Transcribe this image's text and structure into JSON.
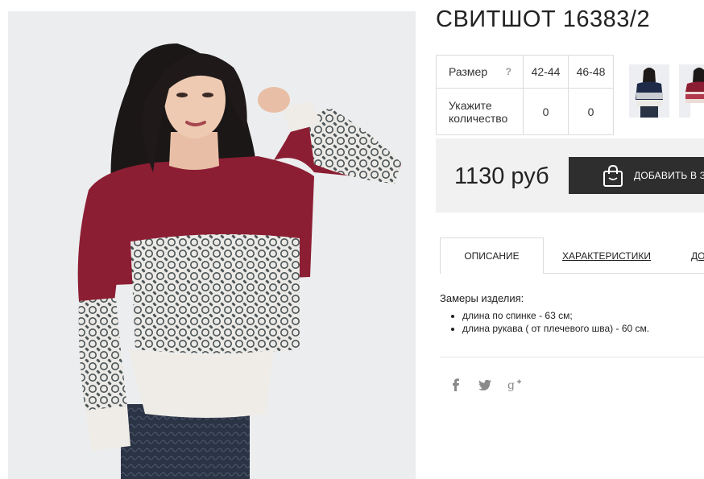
{
  "product": {
    "title": "СВИТШОТ 16383/2",
    "photo_alt": "woman-in-burgundy-lace-sweatshirt"
  },
  "size_table": {
    "size_label": "Размер",
    "help_mark": "?",
    "sizes": [
      "42-44",
      "46-48"
    ],
    "quantity_label_line1": "Укажите",
    "quantity_label_line2": "количество",
    "quantities": [
      "0",
      "0"
    ]
  },
  "thumbnails": [
    {
      "name": "thumb-navy-variant"
    },
    {
      "name": "thumb-red-variant"
    }
  ],
  "price": {
    "value": "1130 руб",
    "add_to_cart_label": "ДОБАВИТЬ В З"
  },
  "tabs": {
    "description": "ОПИСАНИЕ",
    "characteristics": "ХАРАКТЕРИСТИКИ",
    "more": "ДО"
  },
  "description": {
    "heading": "Замеры изделия:",
    "items": [
      "длина по спинке - 63 см;",
      "длина рукава ( от плечевого шва) - 60 см."
    ]
  },
  "social": [
    {
      "icon": "facebook-icon",
      "glyph": "f"
    },
    {
      "icon": "twitter-icon",
      "glyph": "t"
    },
    {
      "icon": "google-plus-icon",
      "glyph": "g+"
    }
  ],
  "colors": {
    "burgundy": "#8c1e33",
    "lace_gray": "#4a5356",
    "cream": "#efece8",
    "button_dark": "#2e2e2e",
    "price_bg": "#f1f1f1",
    "border": "#dcdcdc"
  }
}
